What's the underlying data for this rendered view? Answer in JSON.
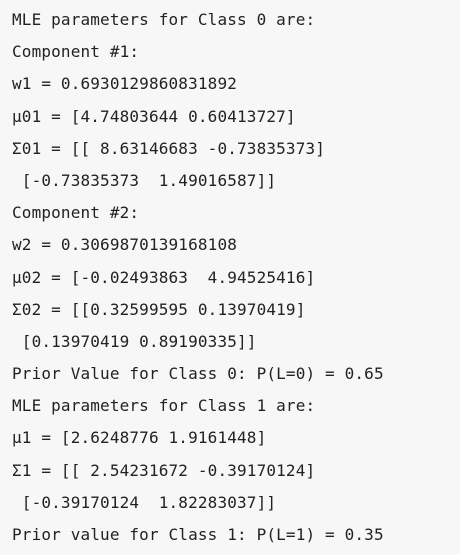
{
  "output": {
    "lines": [
      "MLE parameters for Class 0 are:",
      "Component #1:",
      "w1 = 0.6930129860831892",
      "μ01 = [4.74803644 0.60413727]",
      "Σ01 = [[ 8.63146683 -0.73835373]",
      " [-0.73835373  1.49016587]]",
      "Component #2:",
      "w2 = 0.3069870139168108",
      "μ02 = [-0.02493863  4.94525416]",
      "Σ02 = [[0.32599595 0.13970419]",
      " [0.13970419 0.89190335]]",
      "Prior Value for Class 0: P(L=0) = 0.65",
      "MLE parameters for Class 1 are:",
      "μ1 = [2.6248776 1.9161448]",
      "Σ1 = [[ 2.54231672 -0.39170124]",
      " [-0.39170124  1.82283037]]",
      "Prior value for Class 1: P(L=1) = 0.35"
    ]
  }
}
